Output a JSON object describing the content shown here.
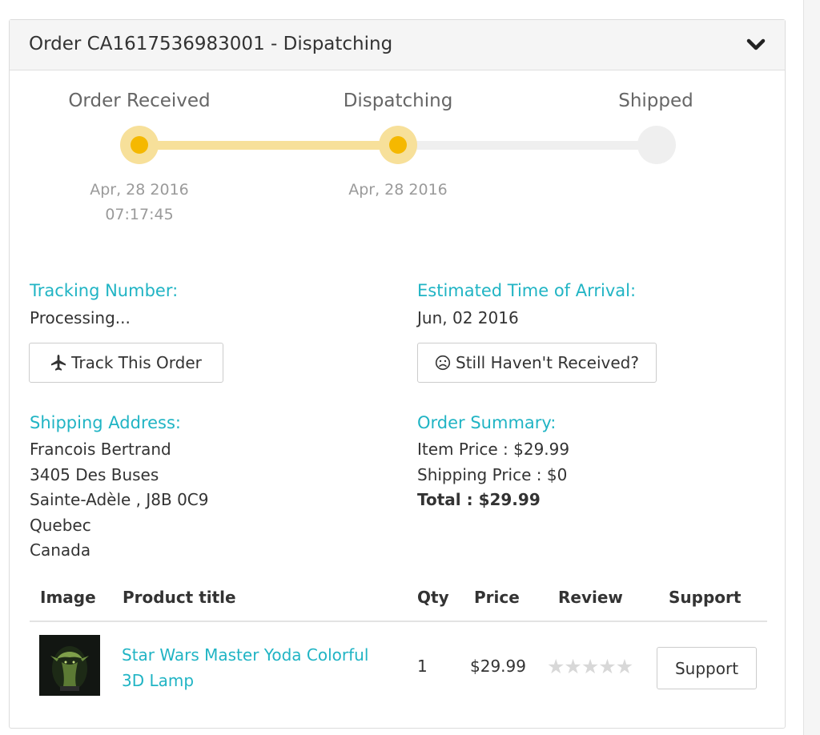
{
  "order": {
    "title": "Order CA1617536983001 - Dispatching"
  },
  "progress": {
    "steps": [
      {
        "label": "Order Received",
        "date": "Apr, 28 2016",
        "time": "07:17:45",
        "done": true
      },
      {
        "label": "Dispatching",
        "date": "Apr, 28 2016",
        "time": "",
        "done": true
      },
      {
        "label": "Shipped",
        "date": "",
        "time": "",
        "done": false
      }
    ],
    "active_color": "#f5b800",
    "active_track_color": "#f7e09a",
    "inactive_color": "#efefef"
  },
  "tracking": {
    "heading": "Tracking Number:",
    "value": "Processing...",
    "button_label": "Track This Order",
    "button_icon": "airplane-icon"
  },
  "eta": {
    "heading": "Estimated Time of Arrival:",
    "value": "Jun, 02 2016",
    "button_label": "Still Haven't Received?",
    "button_icon": "sad-face-icon"
  },
  "shipping": {
    "heading": "Shipping Address:",
    "lines": [
      "Francois Bertrand",
      "3405 Des Buses",
      "Sainte-Adèle , J8B 0C9",
      "Quebec",
      "Canada"
    ]
  },
  "summary": {
    "heading": "Order Summary:",
    "item_price": "Item Price : $29.99",
    "shipping_price": "Shipping Price : $0",
    "total": "Total : $29.99"
  },
  "table": {
    "headers": [
      "Image",
      "Product title",
      "Qty",
      "Price",
      "Review",
      "Support"
    ],
    "rows": [
      {
        "title": "Star Wars Master Yoda Colorful 3D Lamp",
        "qty": "1",
        "price": "$29.99",
        "rating": 0,
        "support_label": "Support"
      }
    ]
  },
  "colors": {
    "accent": "#20b4c4",
    "header_bg": "#f5f5f5"
  }
}
